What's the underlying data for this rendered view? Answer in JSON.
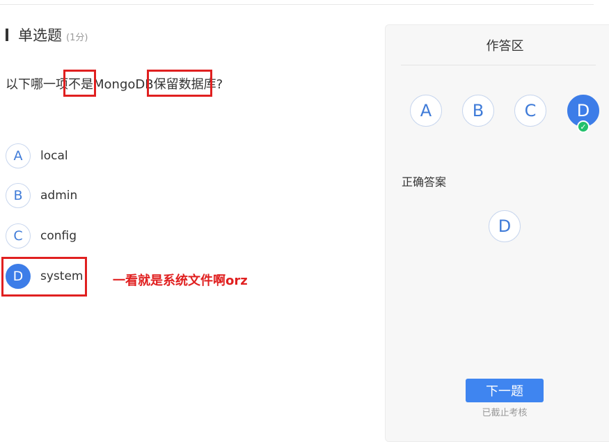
{
  "question": {
    "type_label": "单选题",
    "score_label": "(1分)",
    "text_parts": [
      "以下哪一项",
      "不是",
      "MongoDB",
      "保留数据库",
      "?"
    ],
    "options": [
      {
        "letter": "A",
        "text": "local",
        "selected": false
      },
      {
        "letter": "B",
        "text": "admin",
        "selected": false
      },
      {
        "letter": "C",
        "text": "config",
        "selected": false
      },
      {
        "letter": "D",
        "text": "system",
        "selected": true
      }
    ]
  },
  "annotation": {
    "note": "一看就是系统文件啊orz",
    "color": "#e02020"
  },
  "answer_panel": {
    "title": "作答区",
    "choices": [
      "A",
      "B",
      "C",
      "D"
    ],
    "selected": "D",
    "correct_label": "正确答案",
    "correct_answer": "D",
    "next_button": "下一题",
    "deadline_text": "已截止考核"
  },
  "colors": {
    "accent": "#3d7de8",
    "check": "#22c06b",
    "annotation": "#e02020"
  }
}
